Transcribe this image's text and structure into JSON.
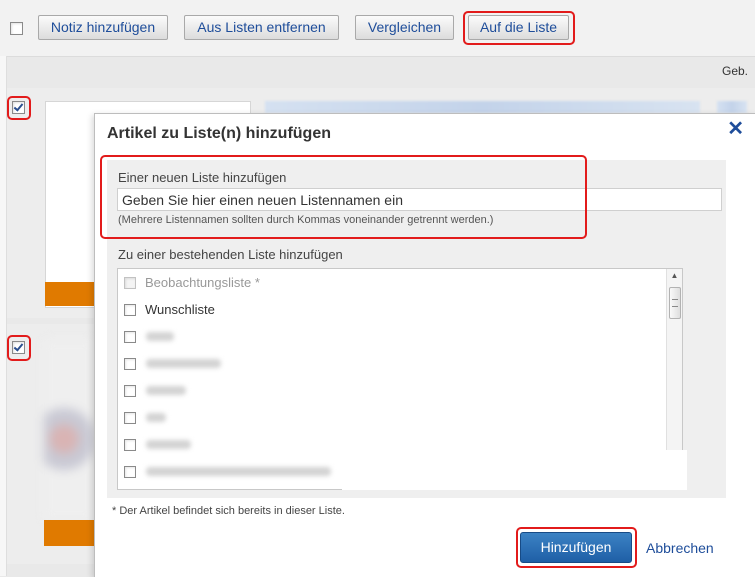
{
  "toolbar": {
    "add_note_label": "Notiz hinzufügen",
    "remove_from_lists_label": "Aus Listen entfernen",
    "compare_label": "Vergleichen",
    "add_to_list_label": "Auf die Liste"
  },
  "header": {
    "column_geb": "Geb."
  },
  "modal": {
    "title": "Artikel zu Liste(n) hinzufügen",
    "close_symbol": "✕",
    "new_list_section_label": "Einer neuen Liste hinzufügen",
    "new_list_input_value": "Geben Sie hier einen neuen Listennamen ein",
    "new_list_hint": "(Mehrere Listennamen sollten durch Kommas voneinander getrennt werden.)",
    "existing_list_section_label": "Zu einer bestehenden Liste hinzufügen",
    "lists": [
      {
        "label": "Beobachtungsliste *",
        "disabled": true,
        "checked": false
      },
      {
        "label": "Wunschliste",
        "disabled": false,
        "checked": false
      },
      {
        "label": "",
        "disabled": false,
        "checked": false,
        "redacted": true
      },
      {
        "label": "",
        "disabled": false,
        "checked": false,
        "redacted": true
      },
      {
        "label": "",
        "disabled": false,
        "checked": false,
        "redacted": true
      },
      {
        "label": "",
        "disabled": false,
        "checked": false,
        "redacted": true
      },
      {
        "label": "",
        "disabled": false,
        "checked": false,
        "redacted": true
      },
      {
        "label": "",
        "disabled": false,
        "checked": false,
        "redacted": true
      }
    ],
    "footnote": "* Der Artikel befindet sich bereits in dieser Liste.",
    "submit_label": "Hinzufügen",
    "cancel_label": "Abbrechen"
  },
  "colors": {
    "link_blue": "#1e4d9a",
    "primary_button": "#2a6db3",
    "highlight_red": "#e21b1b",
    "orange": "#e07a00"
  },
  "icons": {
    "close": "close-icon",
    "scroll_up": "scroll-up-arrow-icon",
    "scroll_down": "scroll-down-arrow-icon"
  }
}
